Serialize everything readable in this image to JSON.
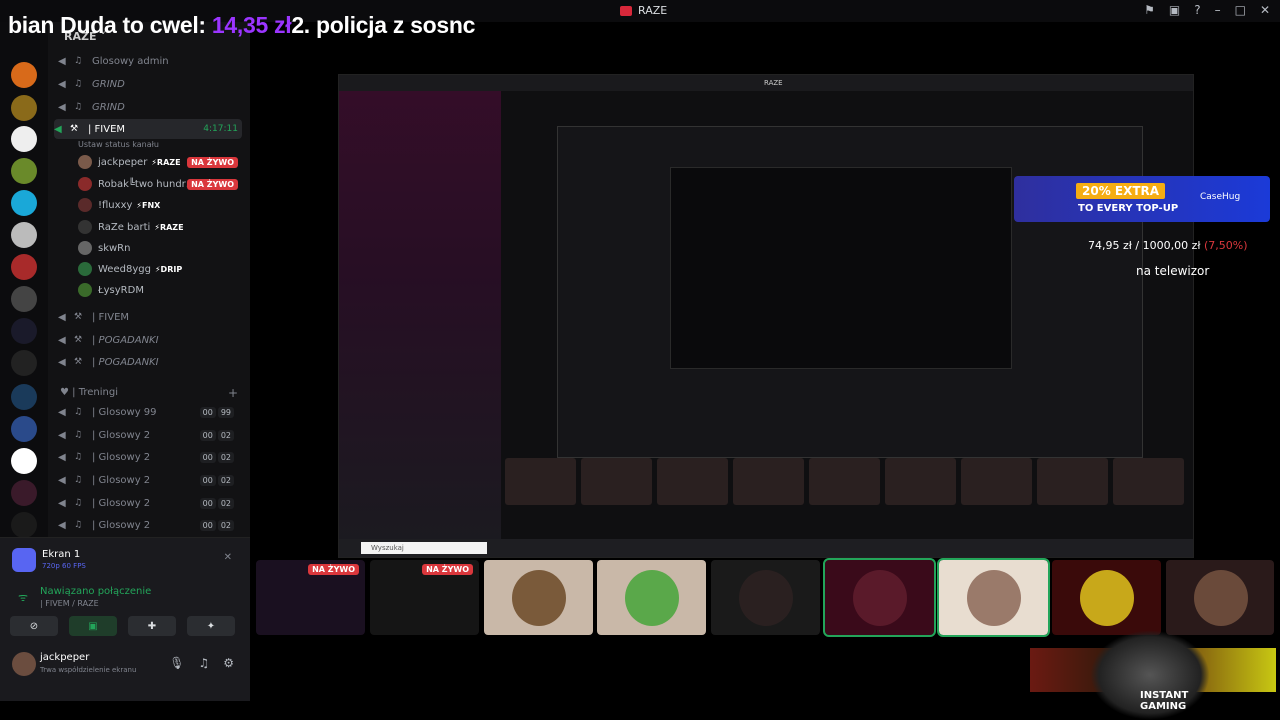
{
  "window": {
    "title": "RAZE"
  },
  "ticker": {
    "prefix": "bian Duda to cwel: ",
    "amount": "14,35 zł",
    "suffix": "2. policja z sosnc"
  },
  "server": {
    "name": "RAZE"
  },
  "channels": [
    {
      "name": "Glosowy admin",
      "italic": false
    },
    {
      "name": "GRIND",
      "italic": true
    },
    {
      "name": "GRIND",
      "italic": true
    },
    {
      "name": "| FIVEM",
      "timer": "4:17:11",
      "active": true
    }
  ],
  "status_line": "Ustaw status kanału",
  "users": [
    {
      "name": "jackpeper",
      "tag": "RAZE",
      "live": "NA ŻYWO"
    },
    {
      "name": "Robak╚two hundr…",
      "tag": "",
      "live": "NA ŻYWO"
    },
    {
      "name": "!fluxxy",
      "tag": "FNX",
      "live": ""
    },
    {
      "name": "RaZe barti",
      "tag": "RAZE",
      "live": ""
    },
    {
      "name": "skwRn",
      "tag": "",
      "live": ""
    },
    {
      "name": "Weed8ygg",
      "tag": "DRIP",
      "live": ""
    },
    {
      "name": "ŁysyRDM",
      "tag": "",
      "live": ""
    }
  ],
  "channels2": [
    {
      "name": "| FIVEM"
    },
    {
      "name": "| POGADANKI"
    },
    {
      "name": "| POGADANKI"
    }
  ],
  "category": {
    "name": "| Treningi",
    "plus": "+"
  },
  "voice_list": [
    {
      "name": "| Glosowy 99",
      "a": "00",
      "b": "99"
    },
    {
      "name": "| Glosowy 2",
      "a": "00",
      "b": "02"
    },
    {
      "name": "| Glosowy 2",
      "a": "00",
      "b": "02"
    },
    {
      "name": "| Glosowy 2",
      "a": "00",
      "b": "02"
    },
    {
      "name": "| Glosowy 2",
      "a": "00",
      "b": "02"
    },
    {
      "name": "| Glosowy 2",
      "a": "00",
      "b": "02"
    }
  ],
  "panel": {
    "screen_title": "Ekran 1",
    "screen_sub": "720p 60 FPS",
    "connection": "Nawiązano połączenie",
    "connection_sub": "| FIVEM / RAZE",
    "user_name": "jackpeper",
    "user_status": "Trwa współdzielenie ekranu"
  },
  "nested": {
    "title": "RAZE",
    "search": "Wyszukaj"
  },
  "ad": {
    "headline": "20% EXTRA",
    "sub": "TO EVERY TOP-UP",
    "brand": "CaseHug"
  },
  "donation": {
    "current": "74,95 zł",
    "sep": " / ",
    "goal": "1000,00 zł",
    "pct": "(7,50%)",
    "caption": "na telewizor"
  },
  "tiles": [
    {
      "badge": "NA ŻYWO"
    },
    {
      "badge": "NA ŻYWO"
    },
    {
      "badge": ""
    },
    {
      "badge": ""
    },
    {
      "badge": ""
    },
    {
      "badge": ""
    },
    {
      "badge": ""
    },
    {
      "badge": ""
    },
    {
      "badge": ""
    }
  ],
  "promo": {
    "line1": "INSTANT",
    "line2": "GAMING"
  },
  "colors": {
    "accent": "#5865f2",
    "live": "#da373c",
    "online": "#23a55a",
    "amount": "#9b35ff"
  }
}
